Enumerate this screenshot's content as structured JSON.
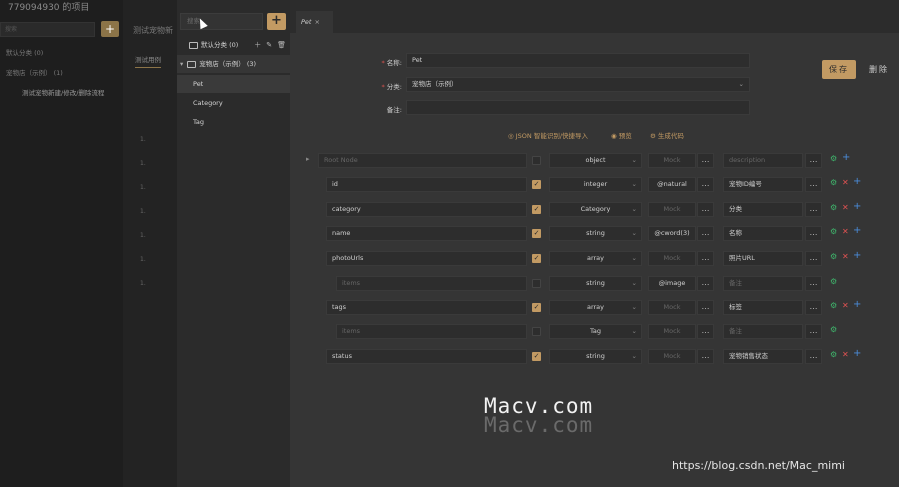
{
  "background": {
    "project_title": "779094930 的项目",
    "search_placeholder": "搜索",
    "add_label": "+",
    "items": [
      "默认分类 (0)",
      "宠物店（示例） (1)",
      "测试宠物新建/修改/删除流程"
    ],
    "mid_title": "测试宠物新",
    "mid_tab": "测试用例",
    "rows": [
      "1.",
      "1.",
      "1.",
      "1.",
      "1.",
      "1.",
      "1."
    ]
  },
  "tree": {
    "search_placeholder": "搜索",
    "add_label": "+",
    "groups": [
      {
        "label": "默认分类 (0)"
      },
      {
        "label": "宠物店（示例） (3)"
      }
    ],
    "items": [
      "Pet",
      "Category",
      "Tag"
    ]
  },
  "tab": {
    "label": "Pet",
    "close": "×"
  },
  "form": {
    "name_label": "名称:",
    "name_value": "Pet",
    "category_label": "分类:",
    "category_value": "宠物店（示例）",
    "note_label": "备注:",
    "note_value": ""
  },
  "actions": {
    "save": "保存",
    "delete": "删除"
  },
  "tools": {
    "json_import": "JSON 智能识别/快捷导入",
    "preview": "预览",
    "codegen": "生成代码"
  },
  "schema_rows": [
    {
      "name": "Root Node",
      "name_dim": true,
      "checked": null,
      "type": "object",
      "mock": "Mock",
      "mock_dim": true,
      "desc": "description",
      "desc_dim": true,
      "gear": true,
      "del": false,
      "plus": true
    },
    {
      "name": "id",
      "checked": true,
      "type": "integer",
      "mock": "@natural",
      "desc": "宠物ID编号",
      "gear": true,
      "del": true,
      "plus": true
    },
    {
      "name": "category",
      "checked": true,
      "type": "Category",
      "mock": "Mock",
      "mock_dim": true,
      "desc": "分类",
      "gear": true,
      "del": true,
      "plus": true
    },
    {
      "name": "name",
      "checked": true,
      "type": "string",
      "mock": "@cword(3)",
      "desc": "名称",
      "gear": true,
      "del": true,
      "plus": true
    },
    {
      "name": "photoUrls",
      "checked": true,
      "type": "array",
      "mock": "Mock",
      "mock_dim": true,
      "desc": "照片URL",
      "gear": true,
      "del": true,
      "plus": true
    },
    {
      "name": "items",
      "name_dim": true,
      "checked": false,
      "type": "string",
      "mock": "@image",
      "desc": "备注",
      "desc_dim": true,
      "gear": true,
      "del": false,
      "plus": false
    },
    {
      "name": "tags",
      "checked": true,
      "type": "array",
      "mock": "Mock",
      "mock_dim": true,
      "desc": "标签",
      "gear": true,
      "del": true,
      "plus": true
    },
    {
      "name": "items",
      "name_dim": true,
      "checked": false,
      "type": "Tag",
      "mock": "Mock",
      "mock_dim": true,
      "desc": "备注",
      "desc_dim": true,
      "gear": true,
      "del": false,
      "plus": false
    },
    {
      "name": "status",
      "checked": true,
      "type": "string",
      "mock": "Mock",
      "mock_dim": true,
      "desc": "宠物销售状态",
      "gear": true,
      "del": true,
      "plus": true
    }
  ],
  "watermark": {
    "line1": "Macv.com",
    "line2": "Macv.com",
    "url": "https://blog.csdn.net/Mac_mimi"
  }
}
